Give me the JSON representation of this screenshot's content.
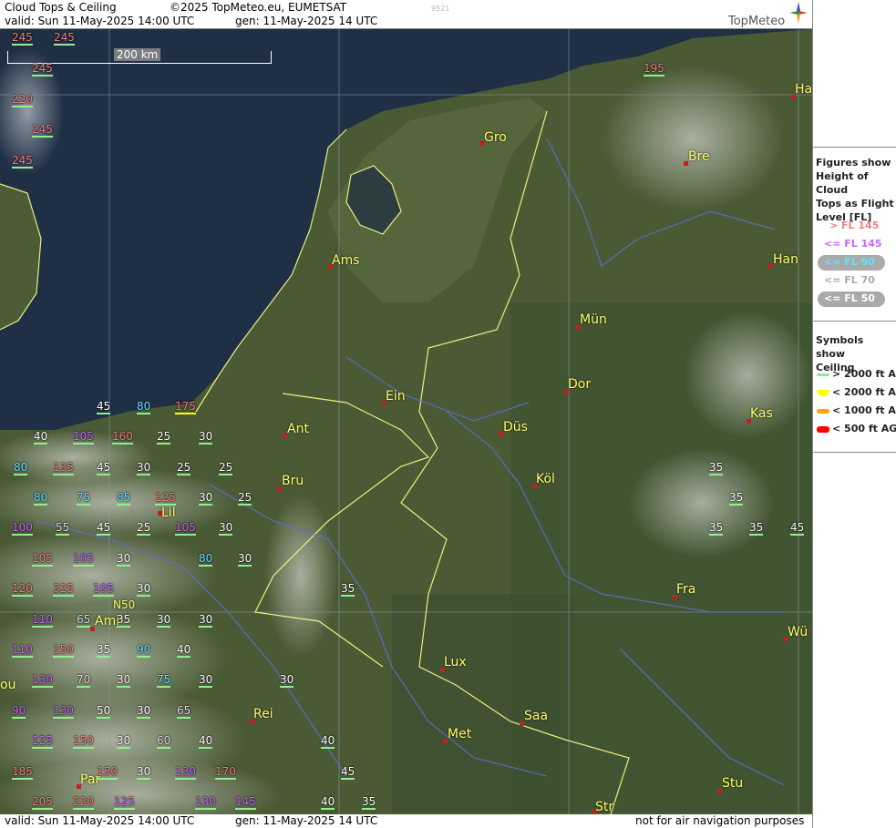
{
  "header": {
    "title": "Cloud Tops & Ceiling",
    "copyright": "©2025 TopMeteo.eu, EUMETSAT",
    "code": "9521",
    "valid": "valid:  Sun  11-May-2025  14:00 UTC",
    "generated": "gen: 11-May-2025 14 UTC",
    "logo": "TopMeteo"
  },
  "footer": {
    "valid": "valid:  Sun  11-May-2025  14:00 UTC",
    "generated": "gen: 11-May-2025 14 UTC",
    "disclaimer": "not for air navigation purposes"
  },
  "scale_label": "200 km",
  "legend": {
    "tops_title": [
      "Figures show",
      "Height of Cloud",
      "Tops as Flight",
      "Level  [FL]"
    ],
    "tops_items": [
      {
        "label": "> FL 145",
        "color": "#f08080"
      },
      {
        "label": "<= FL 145",
        "color": "#cc66ff"
      },
      {
        "label": "<= FL 90",
        "color": "#66e0ff"
      },
      {
        "label": "<= FL 70",
        "color": "#dddddd"
      },
      {
        "label": "<= FL 50",
        "color": "#ffffff"
      }
    ],
    "ceiling_title": [
      "Symbols show",
      "Ceiling"
    ],
    "ceiling_items": [
      {
        "label": "> 2000 ft AGL",
        "color": "#90ee90"
      },
      {
        "label": "< 2000 ft AGL",
        "color": "#ffff00"
      },
      {
        "label": "< 1000 ft AGL",
        "color": "#ffa500"
      },
      {
        "label": "< 500 ft AGL",
        "color": "#ff0000"
      }
    ]
  },
  "cities": [
    {
      "name": "Gro"
    },
    {
      "name": "Ams"
    },
    {
      "name": "Bre"
    },
    {
      "name": "Han"
    },
    {
      "name": "Ha"
    },
    {
      "name": "Mün"
    },
    {
      "name": "Dor"
    },
    {
      "name": "Ein"
    },
    {
      "name": "Ant"
    },
    {
      "name": "Düs"
    },
    {
      "name": "Kas"
    },
    {
      "name": "Bru"
    },
    {
      "name": "Köl"
    },
    {
      "name": "Lil"
    },
    {
      "name": "Ami"
    },
    {
      "name": "Fra"
    },
    {
      "name": "Wü"
    },
    {
      "name": "Lux"
    },
    {
      "name": "Rei"
    },
    {
      "name": "Saa"
    },
    {
      "name": "Met"
    },
    {
      "name": "Par"
    },
    {
      "name": "Stu"
    },
    {
      "name": "Str"
    },
    {
      "name": "N50"
    },
    {
      "name": "ou"
    }
  ],
  "cloud_tops": [
    "245",
    "245",
    "245",
    "220",
    "245",
    "245",
    "195",
    "45",
    "80",
    "175",
    "40",
    "105",
    "160",
    "25",
    "30",
    "80",
    "135",
    "45",
    "30",
    "25",
    "25",
    "80",
    "75",
    "85",
    "125",
    "30",
    "25",
    "100",
    "55",
    "45",
    "25",
    "105",
    "30",
    "105",
    "105",
    "30",
    "80",
    "30",
    "120",
    "325",
    "105",
    "30",
    "35",
    "110",
    "65",
    "35",
    "30",
    "30",
    "110",
    "150",
    "35",
    "90",
    "40",
    "130",
    "70",
    "30",
    "75",
    "30",
    "30",
    "90",
    "130",
    "50",
    "30",
    "65",
    "125",
    "150",
    "30",
    "60",
    "40",
    "40",
    "185",
    "150",
    "30",
    "130",
    "170",
    "45",
    "205",
    "220",
    "125",
    "130",
    "145",
    "40",
    "35",
    "35",
    "35",
    "35",
    "35",
    "45"
  ]
}
